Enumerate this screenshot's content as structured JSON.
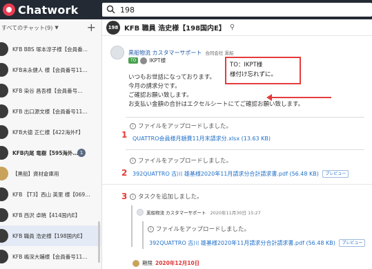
{
  "app": {
    "name": "Chatwork"
  },
  "search": {
    "value": "198"
  },
  "sidebar": {
    "filter_label": "すべてのチャット(9)",
    "rooms": [
      {
        "label": "KFB BBS 塚本淳子様【会員番…"
      },
      {
        "label": "KFB末永健人 様【会員番号11…"
      },
      {
        "label": "KFB 染谷 昌吾様【会員番号…"
      },
      {
        "label": "KFB 出口源文様【会員番号11…"
      },
      {
        "label": "KFB大德 正仁様【422海外F】"
      },
      {
        "label": "KFB内尾 竜樹【595海外…",
        "unread": "1"
      },
      {
        "label": "【黒船】資材倉庫用"
      },
      {
        "label": "KFB 【T3】西山 英里 様【069…"
      },
      {
        "label": "KFB 西沢 卓暁【414国内E】"
      },
      {
        "label": "KFB 職員 浩史様【198国内E】"
      },
      {
        "label": "KFB 嶋深大輔様【会員番号11…"
      }
    ]
  },
  "room": {
    "avatar_text": "198",
    "title": "KFB 職員 浩史様【198国内E】"
  },
  "message": {
    "sender": "黒船物流 カスタマーサポート",
    "org": "合同会社 黒船",
    "to_badge": "TO",
    "to_name": "IKPT様",
    "lines": [
      "いつもお世話になっております。",
      "今月の請求分です。",
      "ご確認お願い致します。",
      "お支払い金額の合計はエクセルシートにてご確認お願い致します。"
    ]
  },
  "callout": {
    "line1": "TO：IKPT様",
    "line2": "様付け忘れずに。"
  },
  "markers": [
    "1",
    "2",
    "3"
  ],
  "uploads": [
    {
      "text": "ファイルをアップロードしました。",
      "file": "QUATTRO会員様月額費11月末請求分.xlsx (13.63 KB)"
    },
    {
      "text": "ファイルをアップロードしました。",
      "file": "392QUATTRO 古川 雄基様2020年11月請求分合計請求書.pdf (56.48 KB)",
      "preview": "プレビュー"
    }
  ],
  "task": {
    "text": "タスクを追加しました。",
    "inner_sender": "黒船物流 カスタマーサポート",
    "inner_time": "2020年11月30日 15:27",
    "inner_upload_text": "ファイルをアップロードしました。",
    "inner_file": "392QUATTRO 古川 雄基様2020年11月請求分合計請求書.pdf (56.48 KB)",
    "inner_preview": "プレビュー",
    "due_label": "期限",
    "due_date": "2020年12月10日"
  },
  "colors": {
    "topbar": "#232a34",
    "accent_red": "#e53b3b",
    "link": "#1f6fc8"
  }
}
